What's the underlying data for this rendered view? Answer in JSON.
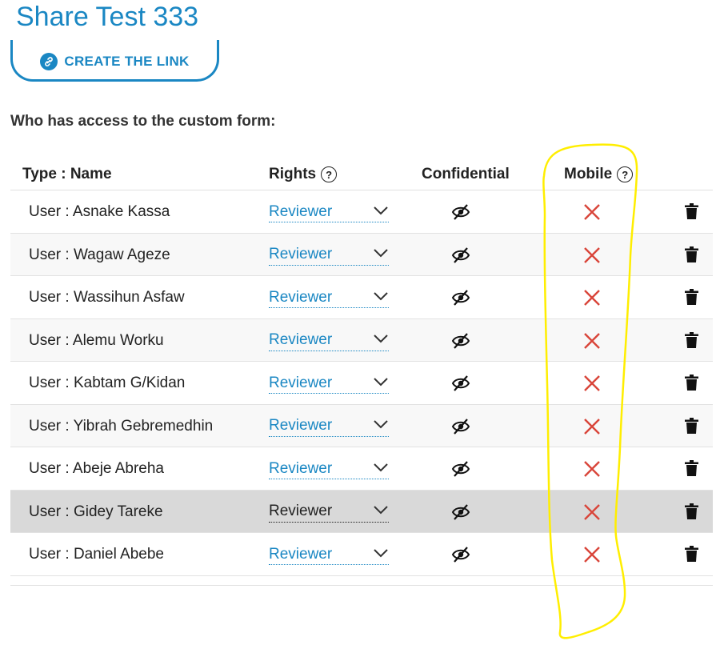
{
  "page": {
    "title": "Share Test 333",
    "create_link_label": "CREATE THE LINK",
    "access_heading": "Who has access to the custom form:"
  },
  "table": {
    "headers": {
      "type_name": "Type : Name",
      "rights": "Rights",
      "confidential": "Confidential",
      "mobile": "Mobile"
    },
    "rows": [
      {
        "name": "User : Asnake Kassa",
        "rights": "Reviewer",
        "confidential": false,
        "mobile": false,
        "selected": false
      },
      {
        "name": "User : Wagaw Ageze",
        "rights": "Reviewer",
        "confidential": false,
        "mobile": false,
        "selected": false
      },
      {
        "name": "User : Wassihun Asfaw",
        "rights": "Reviewer",
        "confidential": false,
        "mobile": false,
        "selected": false
      },
      {
        "name": "User : Alemu Worku",
        "rights": "Reviewer",
        "confidential": false,
        "mobile": false,
        "selected": false
      },
      {
        "name": "User : Kabtam G/Kidan",
        "rights": "Reviewer",
        "confidential": false,
        "mobile": false,
        "selected": false
      },
      {
        "name": "User : Yibrah Gebremedhin",
        "rights": "Reviewer",
        "confidential": false,
        "mobile": false,
        "selected": false
      },
      {
        "name": "User : Abeje Abreha",
        "rights": "Reviewer",
        "confidential": false,
        "mobile": false,
        "selected": false
      },
      {
        "name": "User : Gidey Tareke",
        "rights": "Reviewer",
        "confidential": false,
        "mobile": false,
        "selected": true
      },
      {
        "name": "User : Daniel Abebe",
        "rights": "Reviewer",
        "confidential": false,
        "mobile": false,
        "selected": false
      }
    ]
  },
  "colors": {
    "accent": "#1a87c3",
    "cross": "#d9453a",
    "annotation": "#ffee00"
  },
  "icons": {
    "link": "link-icon",
    "help": "help-circle-icon",
    "confidential": "eye-slash-icon",
    "mobile_off": "cross-icon",
    "delete": "trash-icon",
    "dropdown": "chevron-down-icon"
  }
}
